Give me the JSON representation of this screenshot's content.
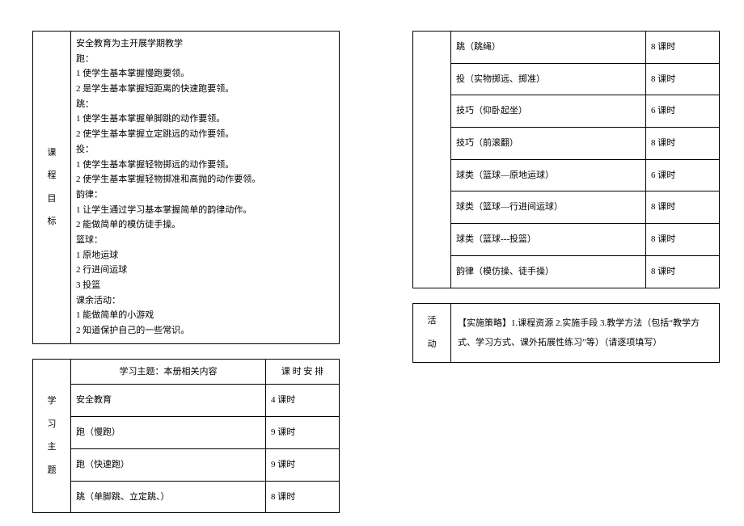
{
  "objectives": {
    "label_chars": [
      "课",
      "程",
      "目",
      "标"
    ],
    "lines": [
      "安全教育为主开展学期教学",
      "跑：",
      "1 使学生基本掌握慢跑要领。",
      "2 是学生基本掌握短距离的快速跑要领。",
      "跳：",
      "1 使学生基本掌握单脚跳的动作要领。",
      "2 使学生基本掌握立定跳远的动作要领。",
      "投：",
      "1 使学生基本掌握轻物掷远的动作要领。",
      "2 使学生基本掌握轻物掷准和高抛的动作要领。",
      "韵律：",
      "1 让学生通过学习基本掌握简单的韵律动作。",
      "2 能做简单的模仿徒手操。",
      "篮球：",
      "1 原地运球",
      "2 行进间运球",
      "3 投篮",
      "课余活动：",
      "1 能做简单的小游戏",
      "2 知道保护自己的一些常识。"
    ]
  },
  "study": {
    "label_chars": [
      "学",
      "习",
      "主",
      "题"
    ],
    "header_theme": "学习主题：本册相关内容",
    "header_hours": "课 时 安 排",
    "rows": [
      {
        "theme": "安全教育",
        "hours": "4 课时"
      },
      {
        "theme": "跑（慢跑）",
        "hours": "9 课时"
      },
      {
        "theme": "跑（快速跑）",
        "hours": "9 课时"
      },
      {
        "theme": "跳（单脚跳、立定跳、）",
        "hours": "8 课时"
      },
      {
        "theme": "跳（跳绳）",
        "hours": "8 课时"
      },
      {
        "theme": "投（实物掷远、掷准）",
        "hours": "8 课时"
      },
      {
        "theme": "技巧（仰卧起坐）",
        "hours": "6 课时"
      },
      {
        "theme": "技巧（前滚翻）",
        "hours": "8 课时"
      },
      {
        "theme": "球类（篮球—原地运球）",
        "hours": "6 课时"
      },
      {
        "theme": "球类（篮球—行进间运球）",
        "hours": "8 课时"
      },
      {
        "theme": "球类（篮球---投篮）",
        "hours": "8 课时"
      },
      {
        "theme": "韵律（模仿操、徒手操）",
        "hours": "8 课时"
      }
    ]
  },
  "activity": {
    "label_chars": [
      "活",
      "动"
    ],
    "text": "【实施策略】1.课程资源 2.实施手段 3.教学方法（包括“教学方式、学习方式、课外拓展性练习”等）（请逐项填写）"
  }
}
